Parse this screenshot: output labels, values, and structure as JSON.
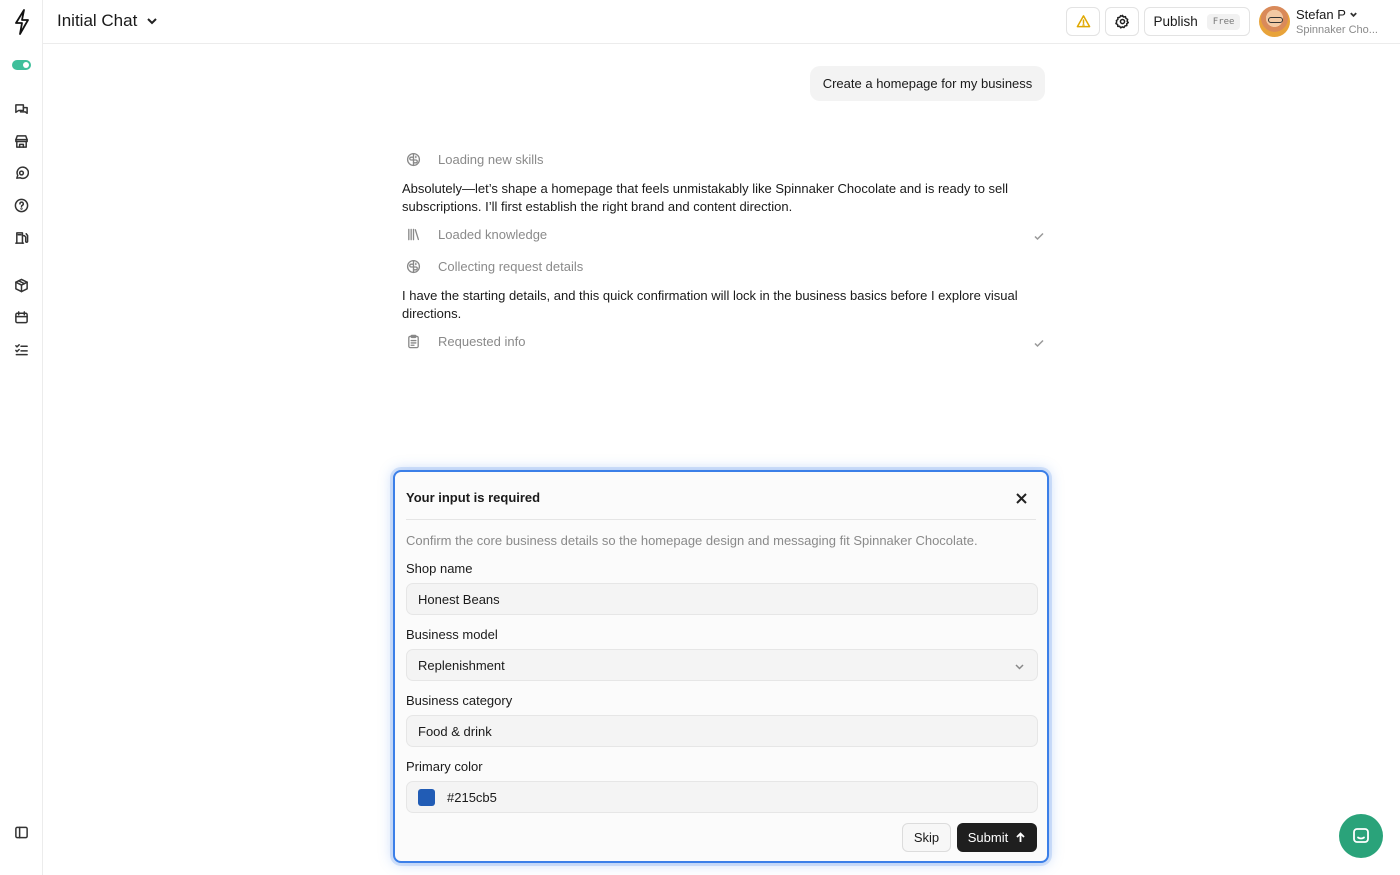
{
  "header": {
    "chat_title": "Initial Chat",
    "publish_label": "Publish",
    "publish_badge": "Free",
    "user_name": "Stefan P",
    "user_org": "Spinnaker Cho..."
  },
  "sidebar": {
    "icons": [
      "logo-bolt-icon",
      "toggle",
      "chats-icon",
      "store-icon",
      "message-icon",
      "help-icon",
      "fuel-icon",
      "package-icon",
      "calendar-icon",
      "checklist-icon",
      "panel-toggle-icon"
    ]
  },
  "conversation": {
    "user_message": "Create a homepage for my business",
    "steps": [
      {
        "label": "Loading new skills",
        "icon": "brain-icon",
        "done": false
      },
      {
        "label": "Loaded knowledge",
        "icon": "library-icon",
        "done": true
      },
      {
        "label": "Collecting request details",
        "icon": "brain-icon",
        "done": false
      },
      {
        "label": "Requested info",
        "icon": "clipboard-icon",
        "done": true
      }
    ],
    "assistant_message_1": "Absolutely—let’s shape a homepage that feels unmistakably like Spinnaker Chocolate and is ready to sell subscriptions. I’ll first establish the right brand and content direction.",
    "assistant_message_2": "I have the starting details, and this quick confirmation will lock in the business basics before I explore visual directions."
  },
  "modal": {
    "title": "Your input is required",
    "description": "Confirm the core business details so the homepage design and messaging fit Spinnaker Chocolate.",
    "fields": {
      "shop_name": {
        "label": "Shop name",
        "value": "Honest Beans"
      },
      "business_model": {
        "label": "Business model",
        "value": "Replenishment"
      },
      "business_category": {
        "label": "Business category",
        "value": "Food & drink"
      },
      "primary_color": {
        "label": "Primary color",
        "value": "#215cb5"
      }
    },
    "skip_label": "Skip",
    "submit_label": "Submit"
  },
  "colors": {
    "accent_border": "#3b7fe8",
    "toggle_green": "#3fbf9b",
    "chat_bubble": "#2aa37a",
    "warning": "#e0a800",
    "primary_swatch": "#215cb5"
  }
}
